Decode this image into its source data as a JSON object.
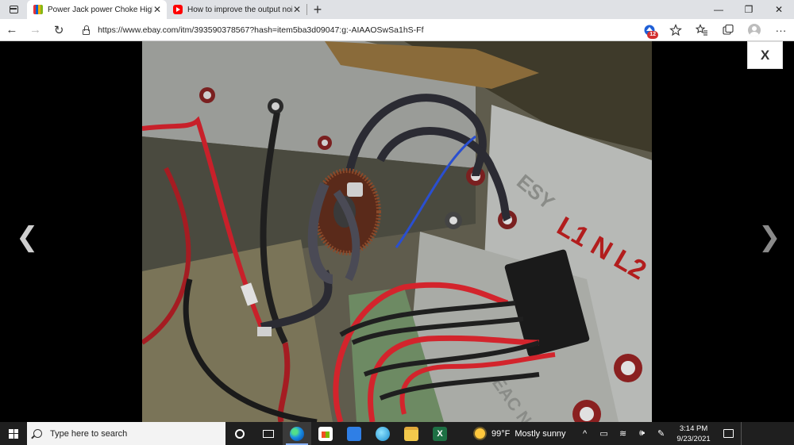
{
  "browser": {
    "tabs": [
      {
        "title": "Power Jack power Choke High C",
        "favicon": "ebay-favicon",
        "active": true
      },
      {
        "title": "How to improve the output nois",
        "favicon": "youtube-favicon",
        "active": false
      }
    ],
    "new_tab_symbol": "+",
    "window_controls": {
      "minimize": "—",
      "maximize": "❐",
      "close": "✕"
    },
    "nav": {
      "back": "←",
      "forward": "→",
      "refresh": "↻"
    },
    "url": "https://www.ebay.com/itm/393590378567?hash=item5ba3d09047:g:-AIAAOSwSa1hS-Ff",
    "toolbar_icons": [
      "tracking-prevention-icon",
      "add-favorite-icon",
      "favorites-icon",
      "collections-icon",
      "profile-icon",
      "more-icon"
    ],
    "tracking_badge": "12",
    "more_symbol": "···"
  },
  "viewer": {
    "prev_arrow": "❮",
    "next_arrow": "❯",
    "close_label": "X",
    "photo_alt": "Power choke toroid with wires"
  },
  "taskbar": {
    "search_placeholder": "Type here to search",
    "apps": [
      "cortana",
      "task-view",
      "edge",
      "microsoft-store",
      "mail",
      "browser",
      "file-explorer",
      "excel"
    ],
    "excel_letter": "X",
    "weather": {
      "temp": "99°F",
      "desc": "Mostly sunny"
    },
    "tray_symbols": {
      "chevron": "^",
      "battery": "▭",
      "wifi": "≋",
      "volume": "🕪",
      "pen": "✎"
    },
    "time": "3:14 PM",
    "date": "9/23/2021"
  }
}
